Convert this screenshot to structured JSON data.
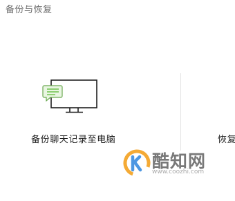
{
  "section": {
    "title": "备份与恢复"
  },
  "actions": {
    "backup_label": "备份聊天记录至电脑",
    "restore_label": "恢复"
  },
  "icons": {
    "backup": "computer-with-chat-bubble-icon",
    "watermark_logo": "coozhi-logo"
  },
  "watermark": {
    "title": "酷知网",
    "url": "www.coozhi.com"
  },
  "colors": {
    "chat_bubble_fill": "#e9f6e2",
    "chat_bubble_stroke": "#6aa84f",
    "chat_lines": "#6cc04a",
    "monitor_stroke": "#1f1f1f",
    "watermark_orange": "#f39c12",
    "watermark_blue": "#2e86de"
  }
}
